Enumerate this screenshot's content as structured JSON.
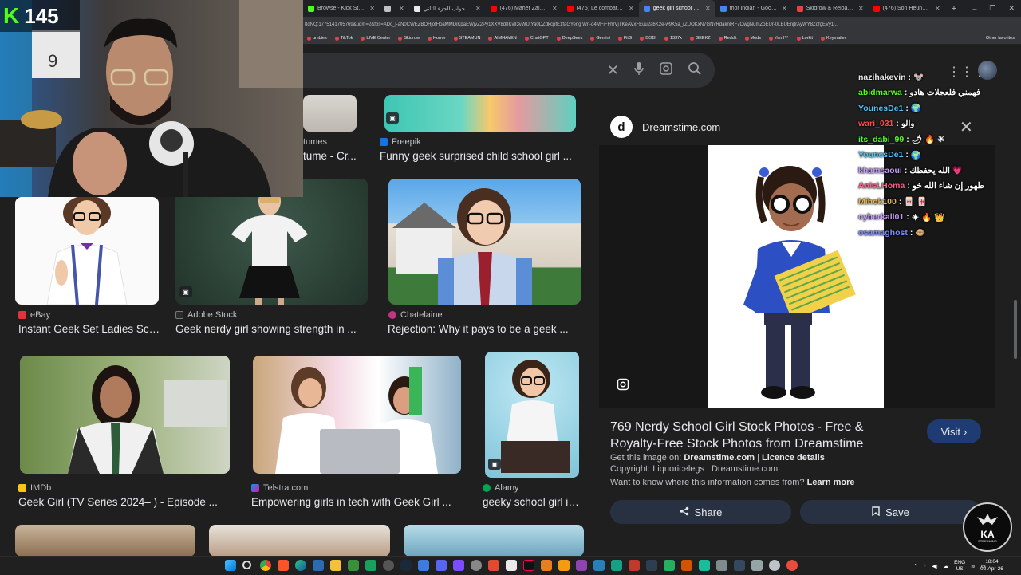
{
  "browser": {
    "tabs": [
      {
        "label": "Browse - Kick Streaming",
        "color": "#53fc18"
      },
      {
        "label": "",
        "color": "#bdc1c6"
      },
      {
        "label": "سؤال وجواب الجزء الثاني",
        "color": "#e8eaed"
      },
      {
        "label": "(476) Maher Zain Full",
        "color": "#ff0000"
      },
      {
        "label": "(476) Le combat final lég",
        "color": "#ff0000"
      },
      {
        "label": "geek girl school - Google",
        "color": "#4285f4",
        "active": true
      },
      {
        "label": "thor indian - Google Sear",
        "color": "#4285f4"
      },
      {
        "label": "Skidrow & Reloaded Gam",
        "color": "#e84142"
      },
      {
        "label": "(476) Son Heungmin Goa",
        "color": "#ff0000"
      }
    ],
    "new_tab": "+",
    "window_controls": [
      "–",
      "❐",
      "✕"
    ],
    "url": "8dNQ:1775141705769&udm=2&fbs=ADc_l-aN0CWEZBOHjofHoaMMDiKpaEWjvZ2Py1XXV8d8KvlI3vWUtYa0DZdkcpfE1faGYeng Wn-q4MFiFFhrVjTKeAVxFEuu2a6K2e-w9K5a_rZUOKxN7GNvRdaknlRF7OwgNumZoEUr-0LBUEnjtrAyWY8ZdfgEVy1j...",
    "bookmarks": [
      "umbies",
      "TikTok",
      "LIVE Center",
      "Skidrow",
      "Horror",
      "STEAMUN",
      "AIMHAVEN",
      "ChatGPT",
      "DeepSeek",
      "Gemini",
      "FitG",
      "DODI",
      "1337x",
      "GEEKZ",
      "Reddit",
      "Mods",
      "Yaml™",
      "Lorkit",
      "Keymailer"
    ],
    "other_favorites": "Other favorites"
  },
  "search": {
    "clear_icon": "✕",
    "mic_icon": "🎤",
    "lens_icon": "⌾",
    "search_icon": "⚲"
  },
  "results": [
    {
      "source": "",
      "title": "tume - Cr...",
      "source_top": "tumes",
      "src_color": "#bdc1c6"
    },
    {
      "source": "Freepik",
      "title": "Funny geek surprised child school girl ...",
      "src_color": "#1273eb"
    },
    {
      "source": "eBay",
      "title": "Instant Geek Set Ladies Sch...",
      "src_color": "#e53238"
    },
    {
      "source": "Adobe Stock",
      "title": "Geek nerdy girl showing strength in ...",
      "src_color": "#2b2b2b"
    },
    {
      "source": "Chatelaine",
      "title": "Rejection: Why it pays to be a geek ...",
      "src_color": "#c13584"
    },
    {
      "source": "IMDb",
      "title": "Geek Girl (TV Series 2024– ) - Episode ...",
      "src_color": "#f5c518"
    },
    {
      "source": "Telstra.com",
      "title": "Empowering girls in tech with Geek Girl ...",
      "src_color": "#0099f8"
    },
    {
      "source": "Alamy",
      "title": "geeky school girl in...",
      "src_color": "#00a656"
    }
  ],
  "panel": {
    "site": "Dreamstime.com",
    "logo_letter": "d",
    "title": "769 Nerdy School Girl Stock Photos - Free & Royalty-Free Stock Photos from Dreamstime",
    "visit": "Visit",
    "get_label": "Get this image on:",
    "get_site": "Dreamstime.com",
    "licence": "Licence details",
    "copyright": "Copyright: Liquoricelegs | Dreamstime.com",
    "want_know": "Want to know where this information comes from?",
    "learn_more": "Learn more",
    "share": "Share",
    "save": "Save"
  },
  "stream": {
    "viewer_count": "145",
    "platform_letter": "K"
  },
  "chat": [
    {
      "user": "nazihakevin",
      "color": "#e8eaed",
      "msg": "🐭"
    },
    {
      "user": "abidmarwa",
      "color": "#53fc18",
      "msg": "فهمني فلعجلات هادو"
    },
    {
      "user": "YounesDe1",
      "color": "#4fc3f7",
      "msg": "🌍"
    },
    {
      "user": "wari_031",
      "color": "#ff4b4b",
      "msg": "والو"
    },
    {
      "user": "its_dabi_99",
      "color": "#53fc18",
      "msg": "🌶 🔥 ☀"
    },
    {
      "user": "YounesDe1",
      "color": "#4fc3f7",
      "msg": "🌍"
    },
    {
      "user": "khamsaoui",
      "color": "#c39bff",
      "msg": "الله يحفظك 💗"
    },
    {
      "user": "AnisLHoma",
      "color": "#ff5c8a",
      "msg": "طهور إن شاء الله خو"
    },
    {
      "user": "Mihok100",
      "color": "#e6b34d",
      "msg": "🀄 🀄"
    },
    {
      "user": "cyberkall01",
      "color": "#c39bff",
      "msg": "☀ 🔥 👑"
    },
    {
      "user": "osamaghost",
      "color": "#7b8cff",
      "msg": "🐵"
    }
  ],
  "watermark": {
    "line1": "KA",
    "line2": "STREAMING"
  },
  "taskbar": {
    "lang": "ENG",
    "region": "US",
    "time": "18:04",
    "date": "02-Apr-26"
  }
}
